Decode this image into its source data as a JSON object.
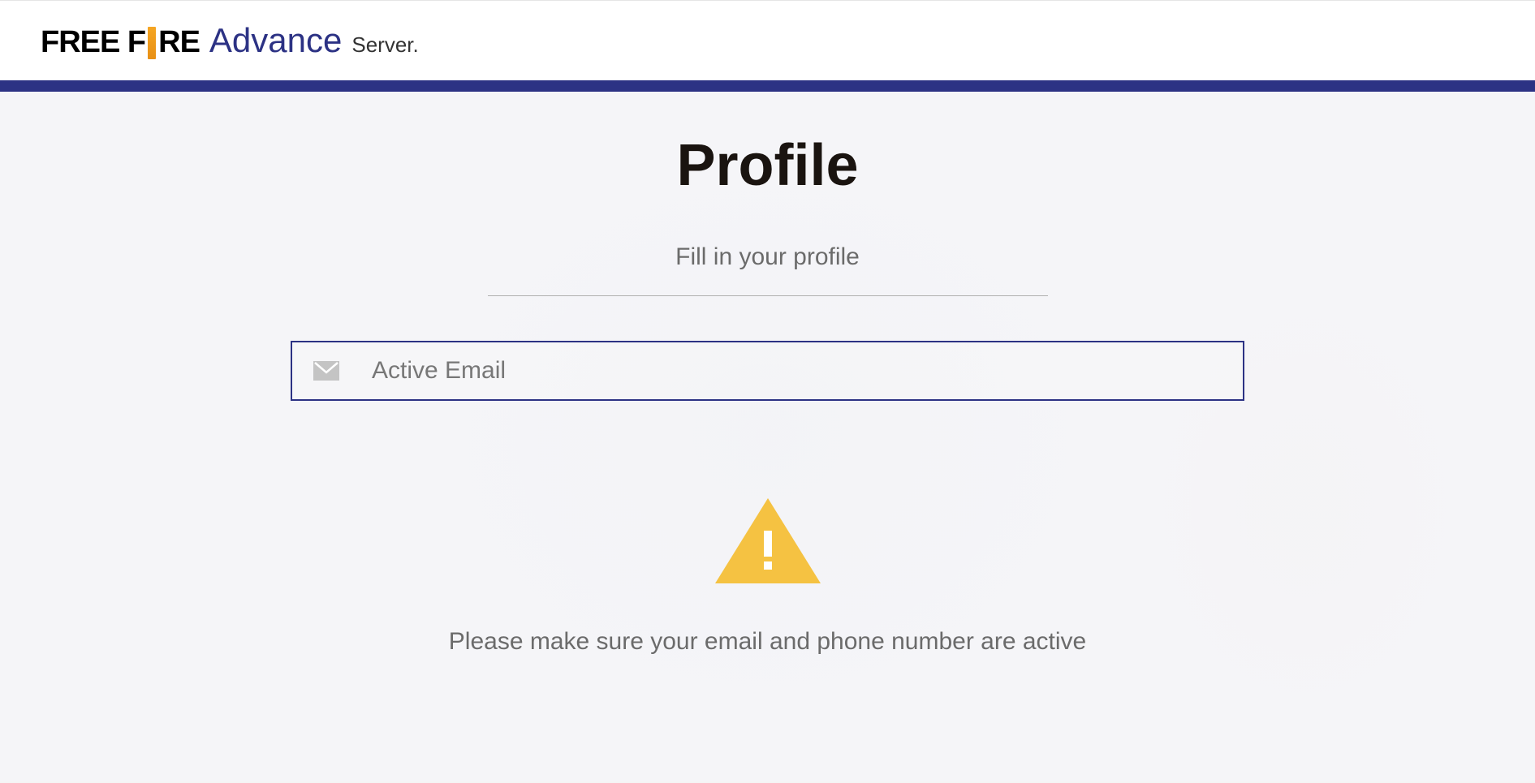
{
  "header": {
    "logo_part1": "FREE F",
    "logo_part2": "RE",
    "logo_advance": "Advance",
    "logo_server": "Server."
  },
  "profile": {
    "title": "Profile",
    "subtitle": "Fill in your profile",
    "email_placeholder": "Active Email",
    "warning_text": "Please make sure your email and phone number are active"
  },
  "colors": {
    "primary": "#2c3284",
    "warning": "#f5c242",
    "text_dark": "#1a1410",
    "text_muted": "#6b6b6b"
  }
}
